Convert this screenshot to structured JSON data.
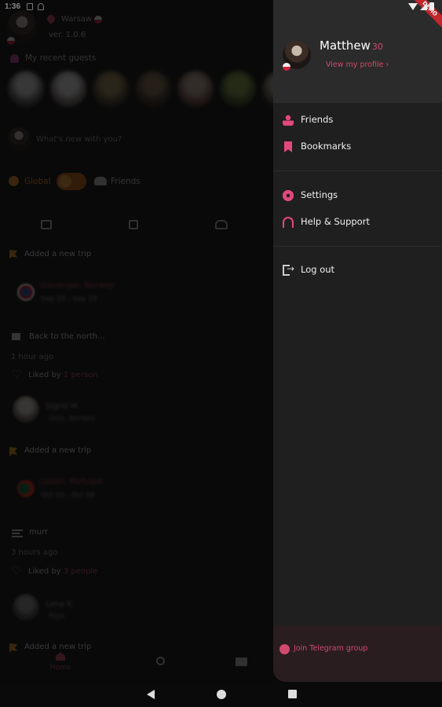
{
  "status_bar": {
    "time": "1:36",
    "banner": "DEMO"
  },
  "background": {
    "location": "Warsaw",
    "version": "ver. 1.0.6",
    "recent_guests_title": "My recent guests",
    "post_placeholder": "What's new with you?",
    "scope": {
      "global_label": "Global",
      "friends_label": "Friends",
      "selected": "Global"
    },
    "feed": [
      {
        "type": "trip",
        "label": "Added a new trip",
        "blur_title": "Stavanger, Norway",
        "blur_sub": "Sep 10 - Sep 15"
      },
      {
        "type": "post",
        "label": "Back to the north...",
        "ago": "1 hour ago",
        "liked_prefix": "Liked by",
        "liked_who": "1 person",
        "blur_title": "Sigrid M.",
        "blur_sub": "Oslo, Norway"
      },
      {
        "type": "trip",
        "label": "Added a new trip",
        "blur_title": "Lisbon, Portugal",
        "blur_sub": "Oct 02 - Oct 08"
      },
      {
        "type": "post",
        "label": "murr",
        "ago": "3 hours ago",
        "liked_prefix": "Liked by",
        "liked_who": "3 people",
        "blur_title": "Lena K.",
        "blur_sub": "Riga"
      },
      {
        "type": "trip",
        "label": "Added a new trip"
      }
    ],
    "bottom_nav": {
      "home_label": "Home"
    }
  },
  "drawer": {
    "user": {
      "name": "Matthew",
      "age": "30",
      "profile_link": "View my profile ›"
    },
    "items_top": [
      {
        "label": "Friends",
        "icon": "person-icon"
      },
      {
        "label": "Bookmarks",
        "icon": "bookmark-icon"
      }
    ],
    "items_mid": [
      {
        "label": "Settings",
        "icon": "gear-icon"
      },
      {
        "label": "Help & Support",
        "icon": "headset-icon"
      }
    ],
    "logout_label": "Log out",
    "telegram_label": "Join Telegram group"
  },
  "colors": {
    "accent": "#d04a6e",
    "orange": "#e8892b",
    "drawer_bg": "#1f1f1f"
  }
}
